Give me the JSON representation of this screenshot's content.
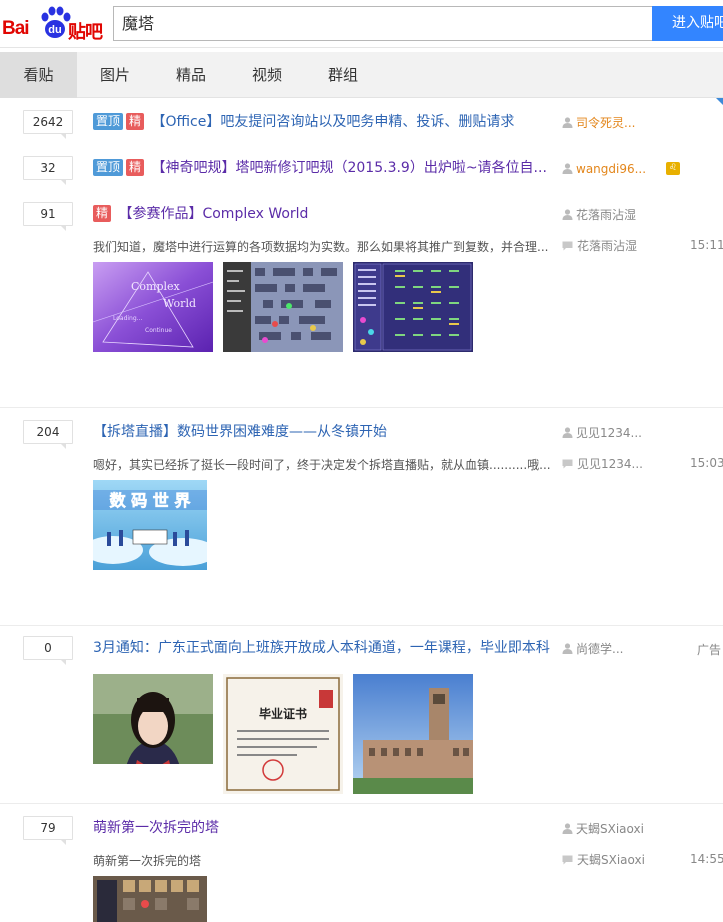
{
  "header": {
    "logo_text_bai": "Bai",
    "logo_text_du": "du",
    "logo_text_tieba": "贴吧",
    "search_value": "魔塔",
    "search_button": "进入贴吧"
  },
  "tabs": [
    {
      "label": "看贴",
      "active": true
    },
    {
      "label": "图片",
      "active": false
    },
    {
      "label": "精品",
      "active": false
    },
    {
      "label": "视频",
      "active": false
    },
    {
      "label": "群组",
      "active": false
    }
  ],
  "threads": [
    {
      "replies": "2642",
      "badges": [
        "置顶",
        "精"
      ],
      "title": "【Office】吧友提问咨询站以及吧务申精、投诉、删贴请求",
      "author": "司令死灵..."
    },
    {
      "replies": "32",
      "badges": [
        "置顶",
        "精"
      ],
      "title": "【神奇吧规】塔吧新修订吧规（2015.3.9）出炉啦~请各位自...",
      "author": "wangdi96...",
      "author_badge": "♌"
    },
    {
      "replies": "91",
      "badges": [
        "精"
      ],
      "title": "【参赛作品】Complex World",
      "author": "花落雨沾湿",
      "abstract": "我们知道，魔塔中进行运算的各项数据均为实数。那么如果将其推广到复数，并合理...",
      "last_replier": "花落雨沾湿",
      "time": "15:11",
      "thumb_texts": [
        "Complex",
        "World",
        "Loading...",
        "Continue"
      ]
    },
    {
      "replies": "204",
      "badges": [],
      "title": "【拆塔直播】数码世界困难难度——从冬镇开始",
      "author": "见见1234...",
      "abstract": "嗯好，其实已经拆了挺长一段时间了，终于决定发个拆塔直播贴，就从血镇..........哦...",
      "last_replier": "见见1234...",
      "time": "15:03",
      "thumb_texts": [
        "数 码 世 界"
      ]
    },
    {
      "replies": "0",
      "badges": [],
      "title": "3月通知：广东正式面向上班族开放成人本科通道，一年课程，毕业即本科",
      "author": "尚德学...",
      "ad": "广告",
      "thumb_texts": [
        "毕业证书"
      ]
    },
    {
      "replies": "79",
      "badges": [],
      "title": "萌新第一次拆完的塔",
      "author": "天蝎SXiaoxi",
      "abstract": "萌新第一次拆完的塔",
      "last_replier": "天蝎SXiaoxi",
      "time": "14:55"
    }
  ],
  "colors": {
    "brand_red": "#e10602",
    "search_blue": "#3385ff",
    "link_blue": "#2d64b3",
    "visited_purple": "#5b2ca8",
    "top_badge": "#4f9ad8",
    "good_badge": "#e85c5c"
  }
}
